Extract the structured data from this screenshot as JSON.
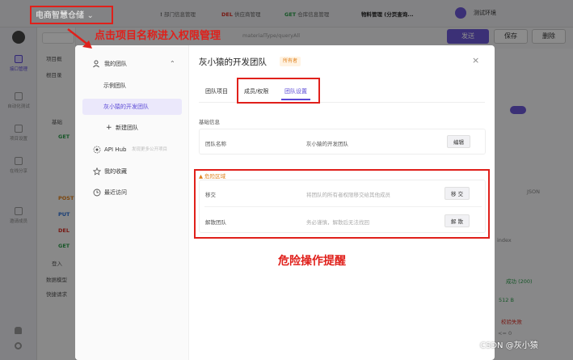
{
  "app": {
    "project_name": "电商智慧仓储",
    "project_caret": "⌄",
    "tabs": [
      {
        "method": "!",
        "label": "部门信息管理"
      },
      {
        "method": "DEL",
        "label": "供应商管理"
      },
      {
        "method": "GET",
        "label": "仓库信息管理"
      },
      {
        "method": "",
        "label": "物料管理 (分页查询..."
      }
    ],
    "environment": "测试环境",
    "url_fragment": "materialType/queryAll",
    "send_label": "发送",
    "save_label": "保存",
    "delete_label": "删除",
    "sidebar_nav": [
      "接口管理",
      "自动化测试",
      "项目设置",
      "在线分享",
      "邀请成员"
    ],
    "tree": [
      {
        "method": "",
        "label": "项目概"
      },
      {
        "method": "",
        "label": "根目录"
      },
      {
        "method": "",
        "label": "基础"
      },
      {
        "method": "GET",
        "label": ""
      },
      {
        "method": "POST",
        "label": ""
      },
      {
        "method": "PUT",
        "label": ""
      },
      {
        "method": "DEL",
        "label": ""
      },
      {
        "method": "GET",
        "label": ""
      },
      {
        "method": "",
        "label": "登入"
      },
      {
        "method": "",
        "label": "数据模型"
      },
      {
        "method": "",
        "label": "快捷请求"
      }
    ],
    "right_panel": {
      "success": "成功 (200)",
      "status_value": "512 B",
      "check_fail": "校验失败",
      "index_label": "index",
      "lte_zero": "<= 0",
      "json_text": "JSON"
    }
  },
  "modal": {
    "sidebar": {
      "my_teams": "我的团队",
      "example_team": "示例团队",
      "selected_team": "灰小猿的开发团队",
      "new_team": "新建团队",
      "api_hub": "API Hub",
      "api_hub_hint": "发现更多公开项目",
      "favorites": "我的收藏",
      "recent": "最近访问"
    },
    "title": "灰小猿的开发团队",
    "owner_badge": "所有者",
    "close": "×",
    "tabs": [
      "团队项目",
      "成员/权限",
      "团队设置"
    ],
    "basic_info_label": "基础信息",
    "team_name_key": "团队名称",
    "team_name_value": "灰小猿的开发团队",
    "edit_button": "编辑",
    "danger_label": "▲ 危险区域",
    "transfer_key": "移交",
    "transfer_hint": "将团队的所有者权限移交给其他成员",
    "transfer_button": "移 交",
    "dissolve_key": "解散团队",
    "dissolve_hint": "务必谨慎，解散后无法找回",
    "dissolve_button": "解 散"
  },
  "annotations": {
    "project_hint": "点击项目名称进入权限管理",
    "danger_hint": "危险操作提醒",
    "watermark": "CSDN @灰小猿"
  },
  "colors": {
    "accent": "#5b49d6",
    "annotation_red": "#e0201b",
    "warning_orange": "#e0801b"
  }
}
